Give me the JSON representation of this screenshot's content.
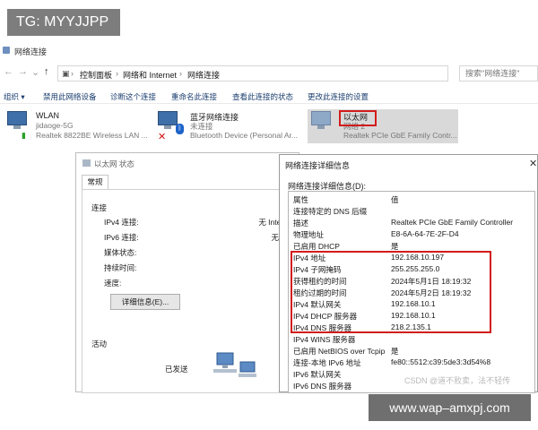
{
  "watermarks": {
    "top": "TG: MYYJJPP",
    "bottom": "www.wap–amxpj.com",
    "csdn": "CSDN @道不败卖，法不轻传"
  },
  "explorer": {
    "title": "网络连接",
    "nav": {
      "back": "←",
      "forward": "→",
      "recent": "⌄",
      "up": "↑"
    },
    "breadcrumb": [
      "控制面板",
      "网络和 Internet",
      "网络连接"
    ],
    "separator": "›",
    "search_placeholder": "搜索\"网络连接\"",
    "commands": [
      "组织 ▾",
      "禁用此网络设备",
      "诊断这个连接",
      "重命名此连接",
      "查看此连接的状态",
      "更改此连接的设置"
    ],
    "adapters": [
      {
        "name": "WLAN",
        "sub": "jidaoge-5G",
        "device": "Realtek 8822BE Wireless LAN ..."
      },
      {
        "name": "蓝牙网络连接",
        "sub": "未连接",
        "device": "Bluetooth Device (Personal Ar..."
      },
      {
        "name": "以太网",
        "sub": "网络 2",
        "device": "Realtek PCIe GbE Family Contr..."
      }
    ]
  },
  "status_dialog": {
    "title": "以太网 状态",
    "tab": "常规",
    "connection_header": "连接",
    "rows": [
      {
        "label": "IPv4 连接:",
        "value": "无 Internet"
      },
      {
        "label": "IPv6 连接:",
        "value": "无网络"
      },
      {
        "label": "媒体状态:",
        "value": ""
      },
      {
        "label": "持续时间:",
        "value": ""
      },
      {
        "label": "速度:",
        "value": ""
      }
    ],
    "details_button": "详细信息(E)...",
    "activity_header": "活动",
    "sent_label": "已发送"
  },
  "detail_dialog": {
    "title": "网络连接详细信息",
    "close": "✕",
    "caption": "网络连接详细信息(D):",
    "columns": [
      "属性",
      "值"
    ],
    "rows": [
      {
        "prop": "连接特定的 DNS 后缀",
        "value": ""
      },
      {
        "prop": "描述",
        "value": "Realtek PCIe GbE Family Controller"
      },
      {
        "prop": "物理地址",
        "value": "E8-6A-64-7E-2F-D4"
      },
      {
        "prop": "已启用 DHCP",
        "value": "是"
      },
      {
        "prop": "IPv4 地址",
        "value": "192.168.10.197"
      },
      {
        "prop": "IPv4 子网掩码",
        "value": "255.255.255.0"
      },
      {
        "prop": "获得租约的时间",
        "value": "2024年5月1日 18:19:32"
      },
      {
        "prop": "租约过期的时间",
        "value": "2024年5月2日 18:19:32"
      },
      {
        "prop": "IPv4 默认网关",
        "value": "192.168.10.1"
      },
      {
        "prop": "IPv4 DHCP 服务器",
        "value": "192.168.10.1"
      },
      {
        "prop": "IPv4 DNS 服务器",
        "value": "218.2.135.1"
      },
      {
        "prop": "IPv4 WINS 服务器",
        "value": ""
      },
      {
        "prop": "已启用 NetBIOS over Tcpip",
        "value": "是"
      },
      {
        "prop": "连接-本地 IPv6 地址",
        "value": "fe80::5512:c39:5de3:3d54%8"
      },
      {
        "prop": "IPv6 默认网关",
        "value": ""
      },
      {
        "prop": "IPv6 DNS 服务器",
        "value": ""
      }
    ]
  },
  "colors": {
    "highlight": "#d21c1c",
    "link": "#1a3d6e",
    "accent": "#3f6fa8"
  }
}
